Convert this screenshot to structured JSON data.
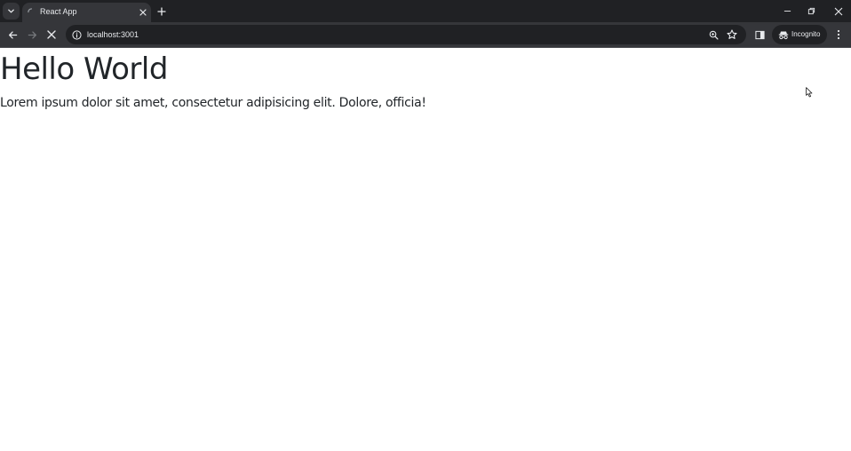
{
  "tab": {
    "title": "React App"
  },
  "address_bar": {
    "url": "localhost:3001"
  },
  "profile": {
    "incognito_label": "Incognito"
  },
  "page": {
    "heading": "Hello World",
    "paragraph": "Lorem ipsum dolor sit amet, consectetur adipisicing elit. Dolore, officia!"
  },
  "theme": {
    "titlebar_bg": "#202124",
    "toolbar_bg": "#35363a",
    "text_color": "#212529"
  }
}
